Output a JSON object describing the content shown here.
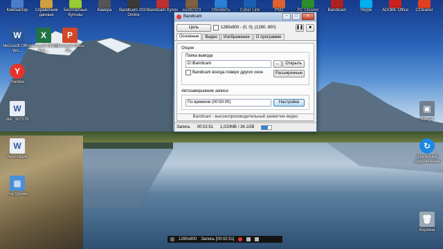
{
  "desktop": {
    "top_icons": [
      {
        "label": "Компьютер",
        "color": "#4a7dc9"
      },
      {
        "label": "Справочник данные",
        "color": "#d0a040"
      },
      {
        "label": "Бесплатные Купоны",
        "color": "#9acd32"
      },
      {
        "label": "Камера",
        "color": "#555555"
      },
      {
        "label": "Bandicam 2020 Online",
        "color": "#3a3a3a"
      },
      {
        "label": "Bandicam Купон",
        "color": "#c03030"
      },
      {
        "label": "ea382323",
        "color": "#806040"
      },
      {
        "label": "Обновить",
        "color": "#2c7fd6"
      },
      {
        "label": "Cyber Link",
        "color": "#1b5fb0"
      },
      {
        "label": "PNG",
        "color": "#e06030"
      },
      {
        "label": "PC Cleaner",
        "color": "#2a8f2a"
      },
      {
        "label": "Bandicam",
        "color": "#b02020"
      },
      {
        "label": "Skype",
        "color": "#00aff0"
      },
      {
        "label": "ADOBE Office",
        "color": "#cc2020"
      },
      {
        "label": "CCleaner",
        "color": "#e04020"
      }
    ],
    "left_icons": [
      {
        "label": "Microsoft Office Wo...",
        "glyph": "W",
        "color": "#2b579a",
        "icon": "word-icon"
      },
      {
        "label": "Microsoft Office Exc...",
        "glyph": "X",
        "color": "#217346",
        "icon": "excel-icon"
      },
      {
        "label": "Microsoft Office Po...",
        "glyph": "P",
        "color": "#d24726",
        "icon": "powerpoint-icon"
      },
      {
        "label": "Yandex",
        "glyph": "Y",
        "color": "#e5352b",
        "icon": "yandex-icon"
      },
      {
        "label": "doc_307578",
        "glyph": "W",
        "color": "#2b579a",
        "icon": "document-icon"
      },
      {
        "label": "Аннотация",
        "glyph": "W",
        "color": "#2b579a",
        "icon": "document-icon"
      },
      {
        "label": "Настройки",
        "glyph": "▦",
        "color": "#4a8fd8",
        "icon": "settings-tiles-icon"
      }
    ],
    "right_icons": [
      {
        "label": "Bengal",
        "glyph": "▣",
        "color": "#708090",
        "icon": "monitor-icon"
      },
      {
        "label": "Удаленный подключения",
        "glyph": "↻",
        "color": "#1e88e5",
        "icon": "remote-connection-icon"
      },
      {
        "label": "Корзина",
        "glyph": "🗑",
        "color": "#9aa7b4",
        "icon": "recycle-bin-icon"
      }
    ]
  },
  "window": {
    "title": "Bandicam",
    "controls": {
      "minimize": "–",
      "maximize": "□",
      "close": "x"
    },
    "toolbar": {
      "target_label": "Цель",
      "resolution": "1280x800 - (0, 0), (1280, 800)",
      "pause_glyph": "❚❚",
      "stop_glyph": "■"
    },
    "tabs": [
      "Основные",
      "Видео",
      "Изображение",
      "О программе"
    ],
    "active_tab": 0,
    "options_group": "Опции",
    "output_folder_label": "Папка вывода",
    "output_folder_value": "D:\\Bandicam",
    "browse_label": "...",
    "open_label": "Открыть",
    "always_on_top_label": "Bandicam всегда поверх других окон",
    "advanced_label": "Расширенные",
    "autostop_label": "Автозавершение записи",
    "autostop_value": "По времени (00:50:00)",
    "settings_label": "Настройки",
    "footer_text": "Bandicam - высокопроизводительный захватчик видео",
    "status": {
      "label": "Запись",
      "time": "00:02:51",
      "size": "1,020MB / 34.1GB",
      "progress": 0.6
    }
  },
  "overlay": {
    "resolution": "1280x800",
    "record_label": "Запись [00:02:51]"
  }
}
